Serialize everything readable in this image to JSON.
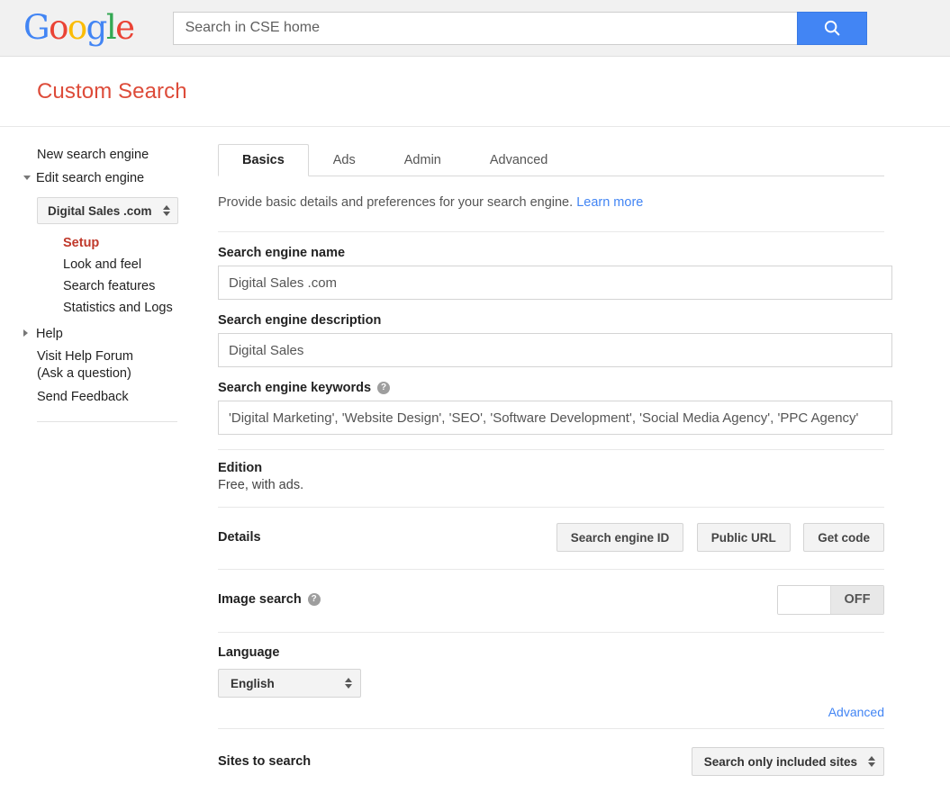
{
  "topbar": {
    "logo_letters": [
      {
        "ch": "G",
        "color": "#4285F4"
      },
      {
        "ch": "o",
        "color": "#EA4335"
      },
      {
        "ch": "o",
        "color": "#FBBC05"
      },
      {
        "ch": "g",
        "color": "#4285F4"
      },
      {
        "ch": "l",
        "color": "#34A853"
      },
      {
        "ch": "e",
        "color": "#EA4335"
      }
    ],
    "search_placeholder": "Search in CSE home",
    "search_value": "",
    "search_button_icon": "search-icon",
    "search_button_color": "#4285F4"
  },
  "header": {
    "title": "Custom Search",
    "title_color": "#dd4b39"
  },
  "sidebar": {
    "new_search_engine": "New search engine",
    "edit_search_engine": "Edit search engine",
    "engine_selector_value": "Digital Sales .com",
    "sub_items": [
      {
        "label": "Setup",
        "active": true
      },
      {
        "label": "Look and feel",
        "active": false
      },
      {
        "label": "Search features",
        "active": false
      },
      {
        "label": "Statistics and Logs",
        "active": false
      }
    ],
    "help": "Help",
    "visit_help_forum_line1": "Visit Help Forum",
    "visit_help_forum_line2": "(Ask a question)",
    "send_feedback": "Send Feedback"
  },
  "tabs": [
    {
      "label": "Basics",
      "active": true
    },
    {
      "label": "Ads",
      "active": false
    },
    {
      "label": "Admin",
      "active": false
    },
    {
      "label": "Advanced",
      "active": false
    }
  ],
  "main": {
    "subtitle_text": "Provide basic details and preferences for your search engine.",
    "subtitle_link": "Learn more",
    "name_label": "Search engine name",
    "name_value": "Digital Sales .com",
    "description_label": "Search engine description",
    "description_value": "Digital Sales",
    "keywords_label": "Search engine keywords",
    "keywords_help_icon": "help-circle-icon",
    "keywords_value": "'Digital Marketing', 'Website Design', 'SEO', 'Software Development', 'Social Media Agency', 'PPC Agency'",
    "edition_label": "Edition",
    "edition_value": "Free, with ads.",
    "details_label": "Details",
    "details_buttons": [
      "Search engine ID",
      "Public URL",
      "Get code"
    ],
    "image_search_label": "Image search",
    "image_search_help_icon": "help-circle-icon",
    "image_search_state": "OFF",
    "language_label": "Language",
    "language_value": "English",
    "advanced_link": "Advanced",
    "sites_to_search_label": "Sites to search",
    "sites_to_search_value": "Search only included sites"
  }
}
